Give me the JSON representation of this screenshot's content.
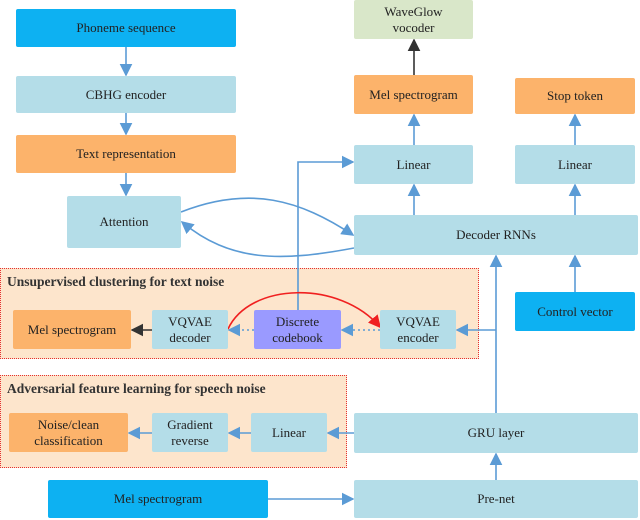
{
  "nodes": {
    "phoneme": "Phoneme sequence",
    "cbhg": "CBHG encoder",
    "text_rep": "Text representation",
    "attention": "Attention",
    "waveglow": "WaveGlow vocoder",
    "mel_top": "Mel spectrogram",
    "stop_token": "Stop token",
    "linear_mel": "Linear",
    "linear_stop": "Linear",
    "decoder_rnns": "Decoder RNNs",
    "control_vector": "Control vector",
    "mel_vq": "Mel spectrogram",
    "vqvae_decoder": "VQVAE decoder",
    "codebook": "Discrete codebook",
    "vqvae_encoder": "VQVAE encoder",
    "noise_clean": "Noise/clean classification",
    "gradient_reverse": "Gradient reverse",
    "linear_adv": "Linear",
    "gru": "GRU layer",
    "mel_input": "Mel spectrogram",
    "prenet": "Pre-net"
  },
  "panels": {
    "unsupervised": "Unsupervised clustering for text noise",
    "adversarial": "Adversarial feature learning for speech noise"
  },
  "colors": {
    "light_blue": "#b4dde8",
    "bright_blue": "#0db1f2",
    "orange": "#fcb36b",
    "green": "#d9e7c9",
    "purple": "#9a9aff",
    "arrow": "#5b9bd5",
    "red_arrow": "#f02020",
    "panel_fill": "#fde5cc"
  }
}
